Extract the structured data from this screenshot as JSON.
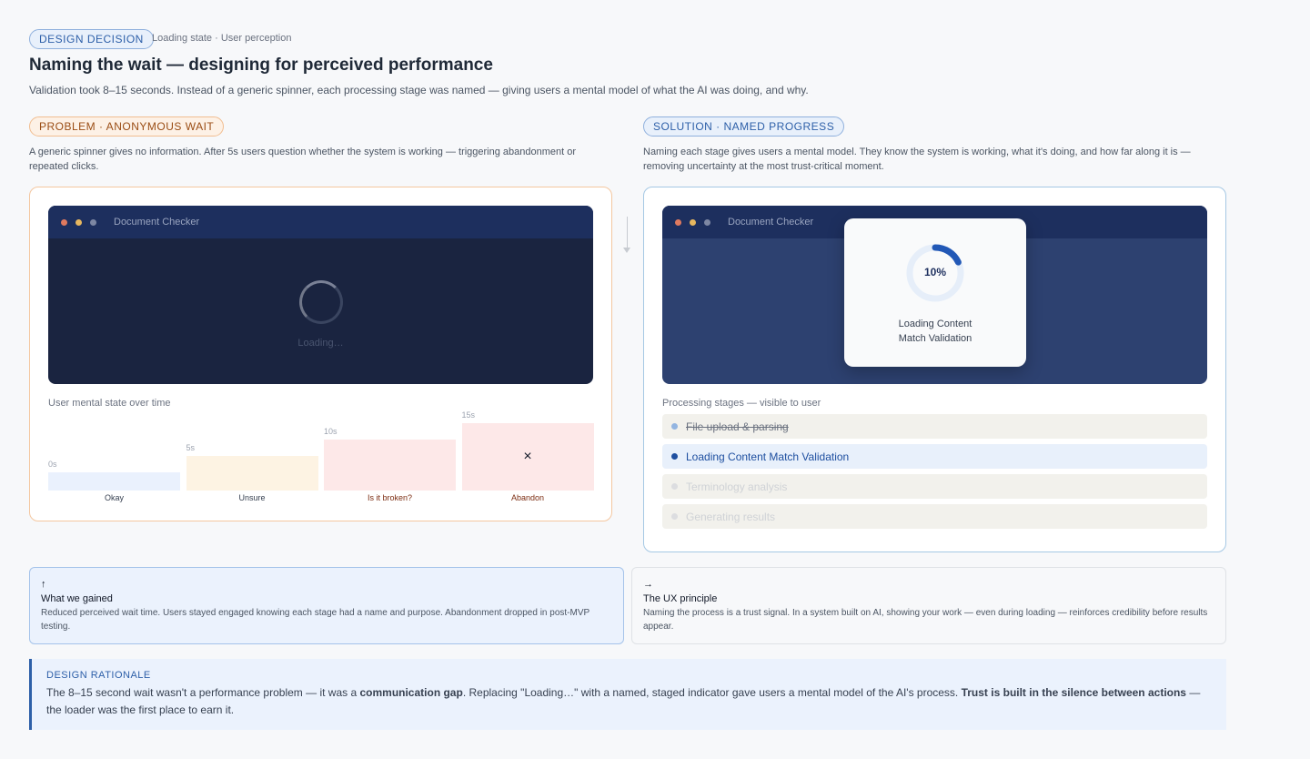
{
  "header": {
    "tag": "DESIGN DECISION",
    "meta": "Loading state · User perception",
    "title": "Naming the wait — designing for perceived performance",
    "subtitle": "Validation took 8–15 seconds. Instead of a generic spinner, each processing stage was named — giving users a mental model of what the AI was doing, and why."
  },
  "problem": {
    "tag": "PROBLEM · ANONYMOUS WAIT",
    "description": "A generic spinner gives no information. After 5s users question whether the system is working — triggering abandonment or repeated clicks.",
    "window_title": "Document Checker",
    "loading_text": "Loading…",
    "chart_title": "User mental state over time",
    "chart_data": {
      "type": "bar",
      "categories": [
        "Okay",
        "Unsure",
        "Is it broken?",
        "Abandon"
      ],
      "time_labels": [
        "0s",
        "5s",
        "10s",
        "15s"
      ],
      "values": [
        1,
        2,
        3,
        4
      ],
      "colors": [
        "#eaf1fd",
        "#fdf3e3",
        "#fde8e8",
        "#fde8e8"
      ],
      "label_colors": [
        "#374151",
        "#374151",
        "#7c2d12",
        "#7c2d12"
      ],
      "abandon_marker": "×"
    }
  },
  "solution": {
    "tag": "SOLUTION · NAMED PROGRESS",
    "description": "Naming each stage gives users a mental model. They know the system is working, what it's doing, and how far along it is — removing uncertainty at the most trust-critical moment.",
    "window_title": "Document Checker",
    "progress_percent": "10%",
    "progress_value": 0.1,
    "dialog_label_line1": "Loading Content",
    "dialog_label_line2": "Match Validation",
    "stages_title": "Processing stages — visible to user",
    "stages": [
      {
        "label": "File upload & parsing",
        "state": "done"
      },
      {
        "label": "Loading Content Match Validation",
        "state": "active"
      },
      {
        "label": "Terminology analysis",
        "state": "pending"
      },
      {
        "label": "Generating results",
        "state": "pending"
      }
    ]
  },
  "gain": {
    "icon": "↑",
    "title": "What we gained",
    "body": "Reduced perceived wait time. Users stayed engaged knowing each stage had a name and purpose. Abandonment dropped in post-MVP testing."
  },
  "principle": {
    "icon": "→",
    "title": "The UX principle",
    "body": "Naming the process is a trust signal. In a system built on AI, showing your work — even during loading — reinforces credibility before results appear."
  },
  "rationale": {
    "title": "DESIGN RATIONALE",
    "part1": "The 8–15 second wait wasn't a performance problem — it was a ",
    "bold1": "communication gap",
    "part2": ". Replacing \"Loading…\" with a named, staged indicator gave users a mental model of the AI's process. ",
    "bold2": "Trust is built in the silence between actions",
    "part3": " — the loader was the first place to earn it."
  },
  "colors": {
    "accent_blue": "#2d5fa8",
    "accent_orange": "#9a4d15",
    "window_dark": "#1a2440"
  }
}
